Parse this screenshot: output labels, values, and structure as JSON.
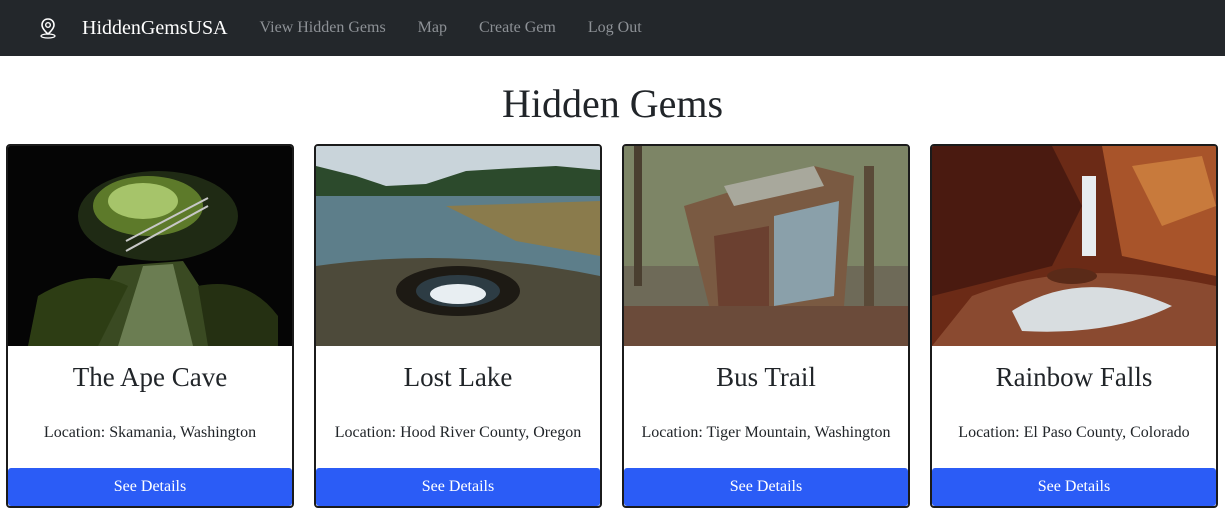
{
  "nav": {
    "brand": "HiddenGemsUSA",
    "links": [
      "View Hidden Gems",
      "Map",
      "Create Gem",
      "Log Out"
    ],
    "icon": "map-pin-icon"
  },
  "page": {
    "title": "Hidden Gems"
  },
  "cards": [
    {
      "title": "The Ape Cave",
      "location": "Location: Skamania, Washington",
      "button": "See Details",
      "image": "cave-photo"
    },
    {
      "title": "Lost Lake",
      "location": "Location: Hood River County, Oregon",
      "button": "See Details",
      "image": "lake-photo"
    },
    {
      "title": "Bus Trail",
      "location": "Location: Tiger Mountain, Washington",
      "button": "See Details",
      "image": "bus-photo"
    },
    {
      "title": "Rainbow Falls",
      "location": "Location: El Paso County, Colorado",
      "button": "See Details",
      "image": "waterfall-photo"
    }
  ],
  "colors": {
    "navbar": "#23272b",
    "button": "#2b5cf6"
  }
}
